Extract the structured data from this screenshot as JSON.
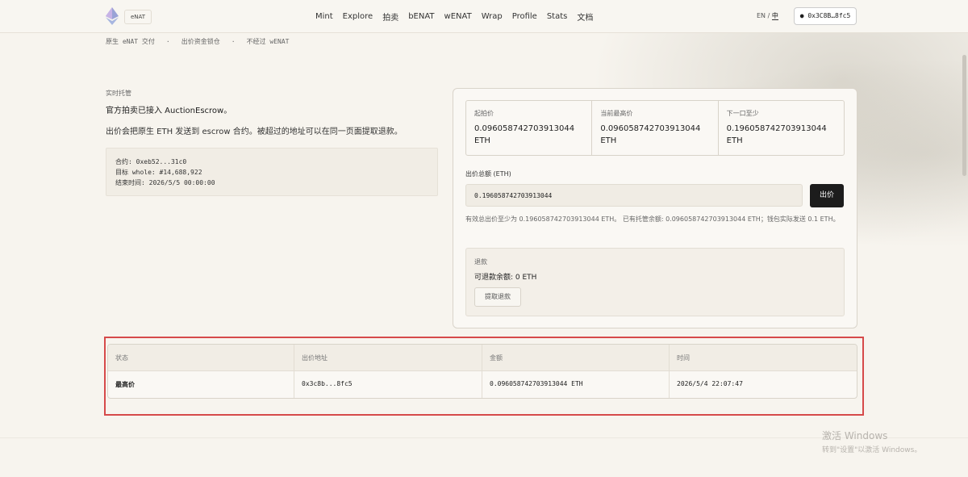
{
  "header": {
    "brand": "eNAT",
    "nav": [
      "Mint",
      "Explore",
      "拍卖",
      "bENAT",
      "wENAT",
      "Wrap",
      "Profile",
      "Stats",
      "文档"
    ],
    "lang_en": "EN",
    "lang_sep": "/",
    "lang_zh": "中",
    "wallet": "● 0x3C8B…8fc5"
  },
  "subnav": [
    "原生 eNAT 交付",
    "出价资金锁仓",
    "不经过 wENAT"
  ],
  "subnav_sep": "·",
  "intro": {
    "label": "实时托管",
    "line1": "官方拍卖已接入 AuctionEscrow。",
    "line2": "出价会把原生 ETH 发送到 escrow 合约。被超过的地址可以在同一页面提取退款。",
    "contract": "合约: 0xeb52...31c0",
    "target": "目标 whole: #14,688,922",
    "end_time": "结束时间: 2026/5/5 00:00:00"
  },
  "stats": [
    {
      "label": "起拍价",
      "value": "0.096058742703913044 ETH"
    },
    {
      "label": "当前最高价",
      "value": "0.096058742703913044 ETH"
    },
    {
      "label": "下一口至少",
      "value": "0.196058742703913044 ETH"
    }
  ],
  "bid": {
    "label": "出价总额 (ETH)",
    "value": "0.196058742703913044",
    "button": "出价",
    "hint": "有效总出价至少为 0.196058742703913044 ETH。 已有托管余额: 0.096058742703913044 ETH；钱包实际发送 0.1 ETH。"
  },
  "refund": {
    "title": "退款",
    "available": "可退款余额: 0 ETH",
    "button": "提取退款"
  },
  "table": {
    "headers": [
      "状态",
      "出价地址",
      "金额",
      "时间"
    ],
    "rows": [
      [
        "最高价",
        "0x3c8b...8fc5",
        "0.096058742703913044 ETH",
        "2026/5/4 22:07:47"
      ]
    ]
  },
  "watermark": {
    "line1": "激活 Windows",
    "line2": "转到\"设置\"以激活 Windows。"
  },
  "colors": {
    "highlight": "#d64a4a",
    "button_dark": "#1c1c1c",
    "background": "#f7f4ee"
  }
}
